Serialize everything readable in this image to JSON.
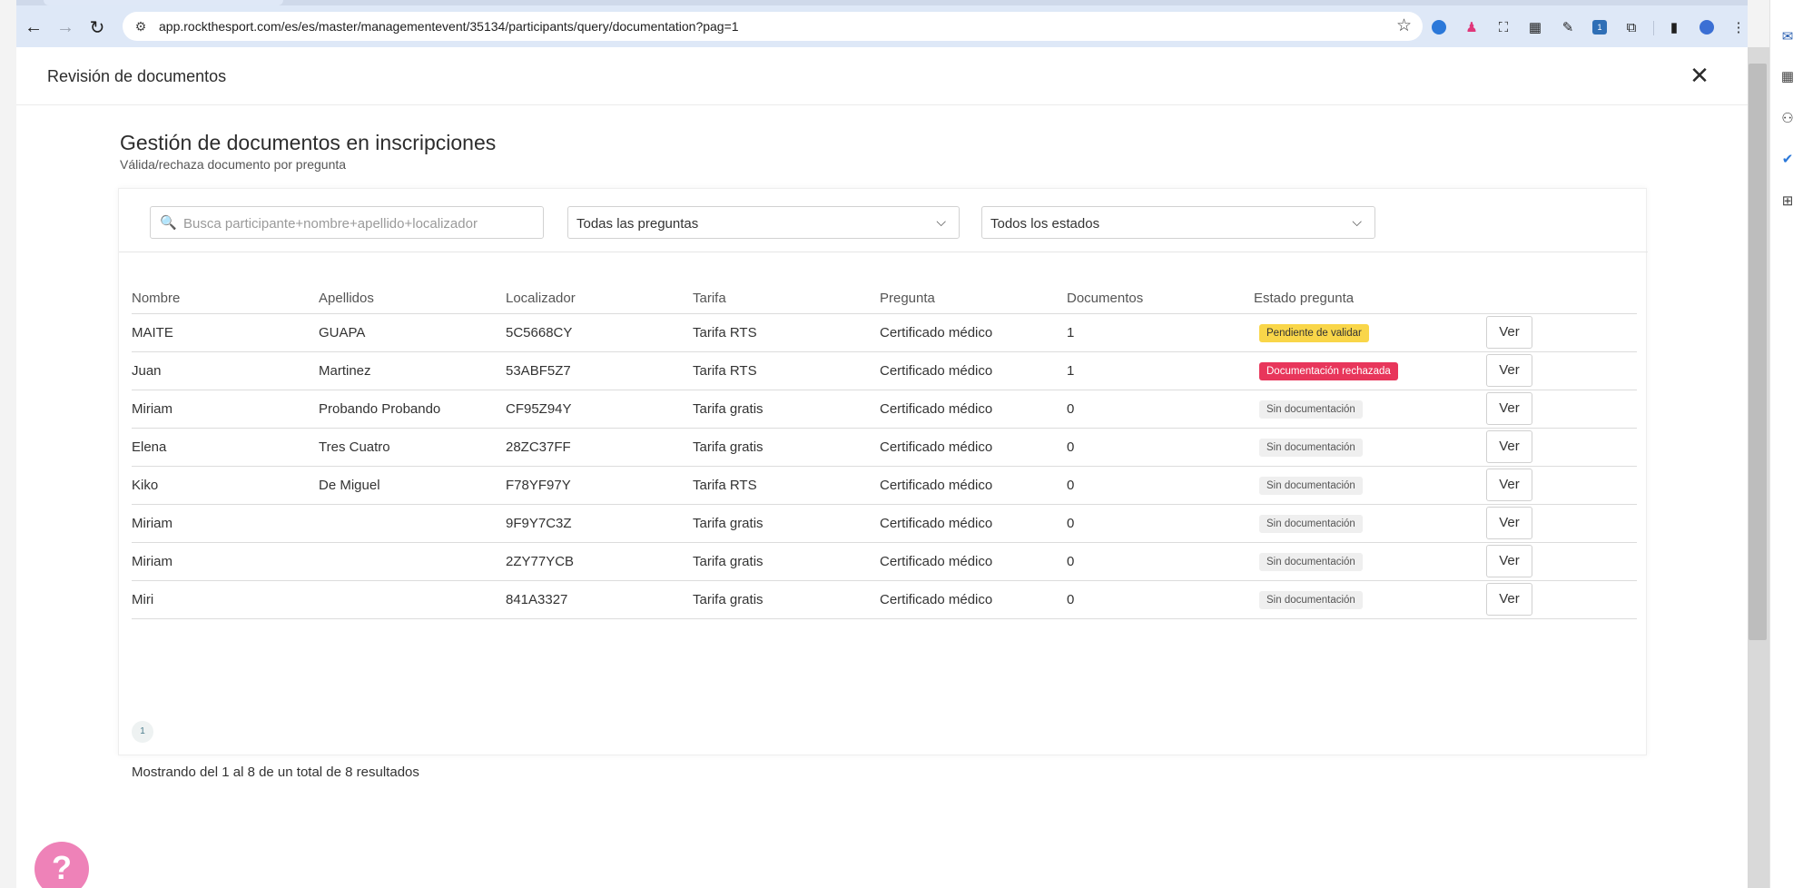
{
  "browser": {
    "url": "app.rockthesport.com/es/es/master/managementevent/35134/participants/query/documentation?pag=1",
    "extension_badge": "1"
  },
  "modal": {
    "title": "Revisión de documentos"
  },
  "page": {
    "heading": "Gestión de documentos en inscripciones",
    "subheading": "Válida/rechaza documento por pregunta"
  },
  "filters": {
    "search_placeholder": "Busca participante+nombre+apellido+localizador",
    "question_select": "Todas las preguntas",
    "status_select": "Todos los estados"
  },
  "table": {
    "columns": [
      "Nombre",
      "Apellidos",
      "Localizador",
      "Tarifa",
      "Pregunta",
      "Documentos",
      "Estado pregunta",
      ""
    ],
    "rows": [
      {
        "nombre": "MAITE",
        "apellidos": "GUAPA",
        "localizador": "5C5668CY",
        "tarifa": "Tarifa RTS",
        "pregunta": "Certificado médico",
        "documentos": "1",
        "estado": "Pendiente de validar",
        "estado_type": "pending",
        "action": "Ver"
      },
      {
        "nombre": "Juan",
        "apellidos": "Martinez",
        "localizador": "53ABF5Z7",
        "tarifa": "Tarifa RTS",
        "pregunta": "Certificado médico",
        "documentos": "1",
        "estado": "Documentación rechazada",
        "estado_type": "rejected",
        "action": "Ver"
      },
      {
        "nombre": "Miriam",
        "apellidos": "Probando Probando",
        "localizador": "CF95Z94Y",
        "tarifa": "Tarifa gratis",
        "pregunta": "Certificado médico",
        "documentos": "0",
        "estado": "Sin documentación",
        "estado_type": "none",
        "action": "Ver"
      },
      {
        "nombre": "Elena",
        "apellidos": "Tres Cuatro",
        "localizador": "28ZC37FF",
        "tarifa": "Tarifa gratis",
        "pregunta": "Certificado médico",
        "documentos": "0",
        "estado": "Sin documentación",
        "estado_type": "none",
        "action": "Ver"
      },
      {
        "nombre": "Kiko",
        "apellidos": "De Miguel",
        "localizador": "F78YF97Y",
        "tarifa": "Tarifa RTS",
        "pregunta": "Certificado médico",
        "documentos": "0",
        "estado": "Sin documentación",
        "estado_type": "none",
        "action": "Ver"
      },
      {
        "nombre": "Miriam",
        "apellidos": "",
        "localizador": "9F9Y7C3Z",
        "tarifa": "Tarifa gratis",
        "pregunta": "Certificado médico",
        "documentos": "0",
        "estado": "Sin documentación",
        "estado_type": "none",
        "action": "Ver"
      },
      {
        "nombre": "Miriam",
        "apellidos": "",
        "localizador": "2ZY77YCB",
        "tarifa": "Tarifa gratis",
        "pregunta": "Certificado médico",
        "documentos": "0",
        "estado": "Sin documentación",
        "estado_type": "none",
        "action": "Ver"
      },
      {
        "nombre": "Miri",
        "apellidos": "",
        "localizador": "841A3327",
        "tarifa": "Tarifa gratis",
        "pregunta": "Certificado médico",
        "documentos": "0",
        "estado": "Sin documentación",
        "estado_type": "none",
        "action": "Ver"
      }
    ]
  },
  "pagination": {
    "current_page": "1",
    "results_text": "Mostrando del 1 al 8 de un total de 8 resultados"
  },
  "help": {
    "label": "?"
  },
  "colors": {
    "pending": "#f9d649",
    "rejected": "#e8365b",
    "help": "#ee82b8"
  }
}
